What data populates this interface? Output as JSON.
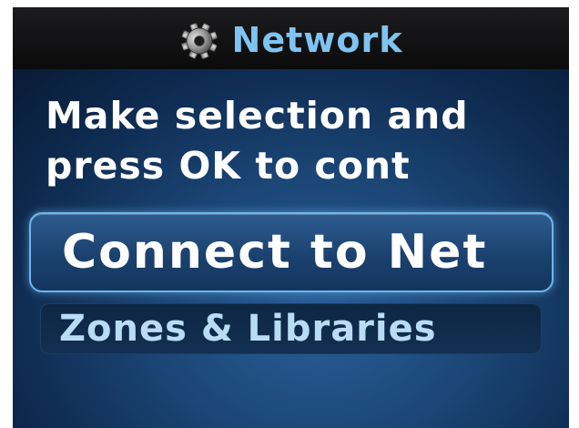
{
  "header": {
    "icon": "gear-icon",
    "title": "Network"
  },
  "prompt": {
    "line1": "Make selection and",
    "line2": "press OK to cont"
  },
  "menu": {
    "items": [
      {
        "label": "Connect to Net",
        "selected": true
      },
      {
        "label": "Zones & Libraries",
        "selected": false
      }
    ]
  },
  "colors": {
    "header_title": "#7fc3f2",
    "highlight_border": "#6db6ec",
    "background": "#1b4676"
  }
}
